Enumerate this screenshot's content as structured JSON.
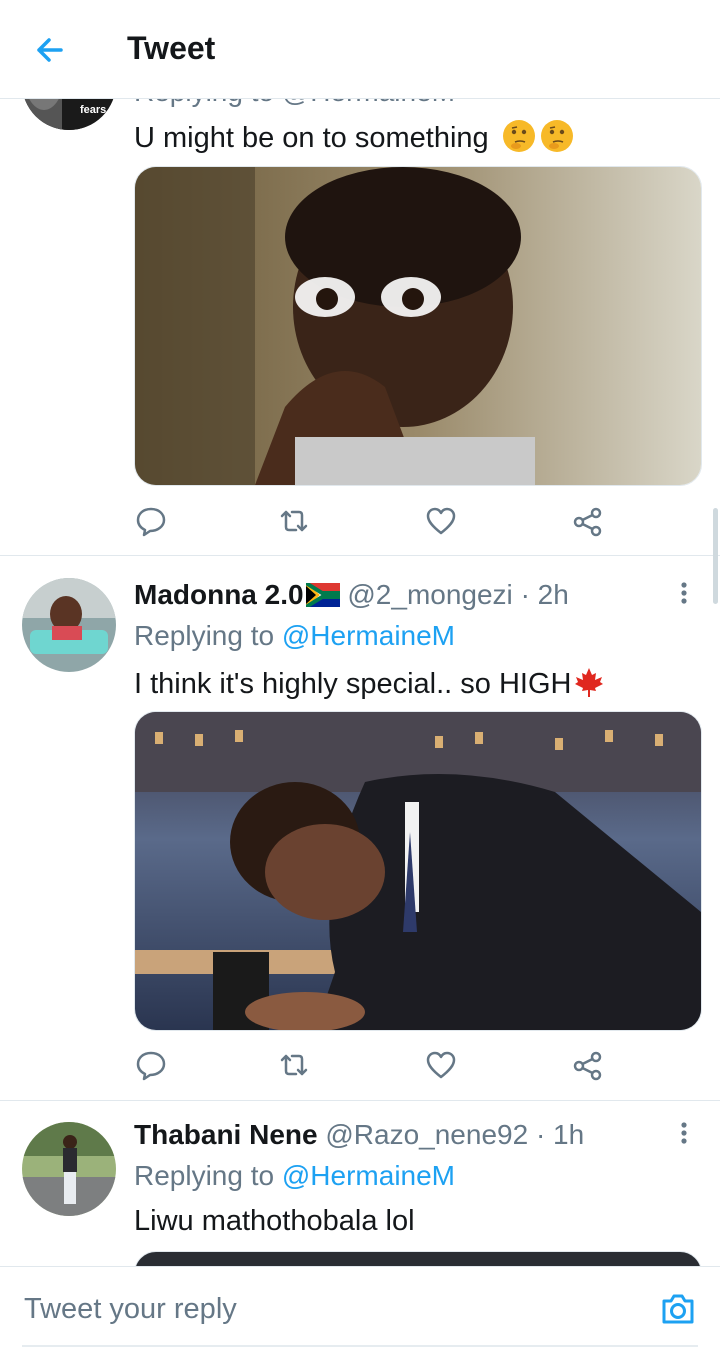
{
  "header": {
    "title": "Tweet"
  },
  "tweets": [
    {
      "partial_reply_text": "Replying to @HermaineM",
      "avatar_caption": "fears.",
      "text": "U might be on to something"
    },
    {
      "name": "Madonna 2.0",
      "handle": "@2_mongezi",
      "time": "· 2h",
      "replying_prefix": "Replying to",
      "replying_handle": "@HermaineM",
      "text": "I think it's highly special.. so HIGH"
    },
    {
      "name": "Thabani Nene",
      "handle": "@Razo_nene92",
      "time": "· 1h",
      "replying_prefix": "Replying to",
      "replying_handle": "@HermaineM",
      "text": "Liwu mathothobala lol"
    }
  ],
  "reply_bar": {
    "placeholder": "Tweet your reply"
  },
  "colors": {
    "accent": "#1da1f2",
    "text": "#14171a",
    "secondary": "#657786",
    "border": "#e1e8ed"
  },
  "icons": [
    "back-arrow-icon",
    "reply-icon",
    "retweet-icon",
    "like-icon",
    "share-icon",
    "more-icon",
    "camera-icon",
    "flag-south-africa-icon",
    "maple-leaf-icon",
    "thinking-face-icon"
  ]
}
